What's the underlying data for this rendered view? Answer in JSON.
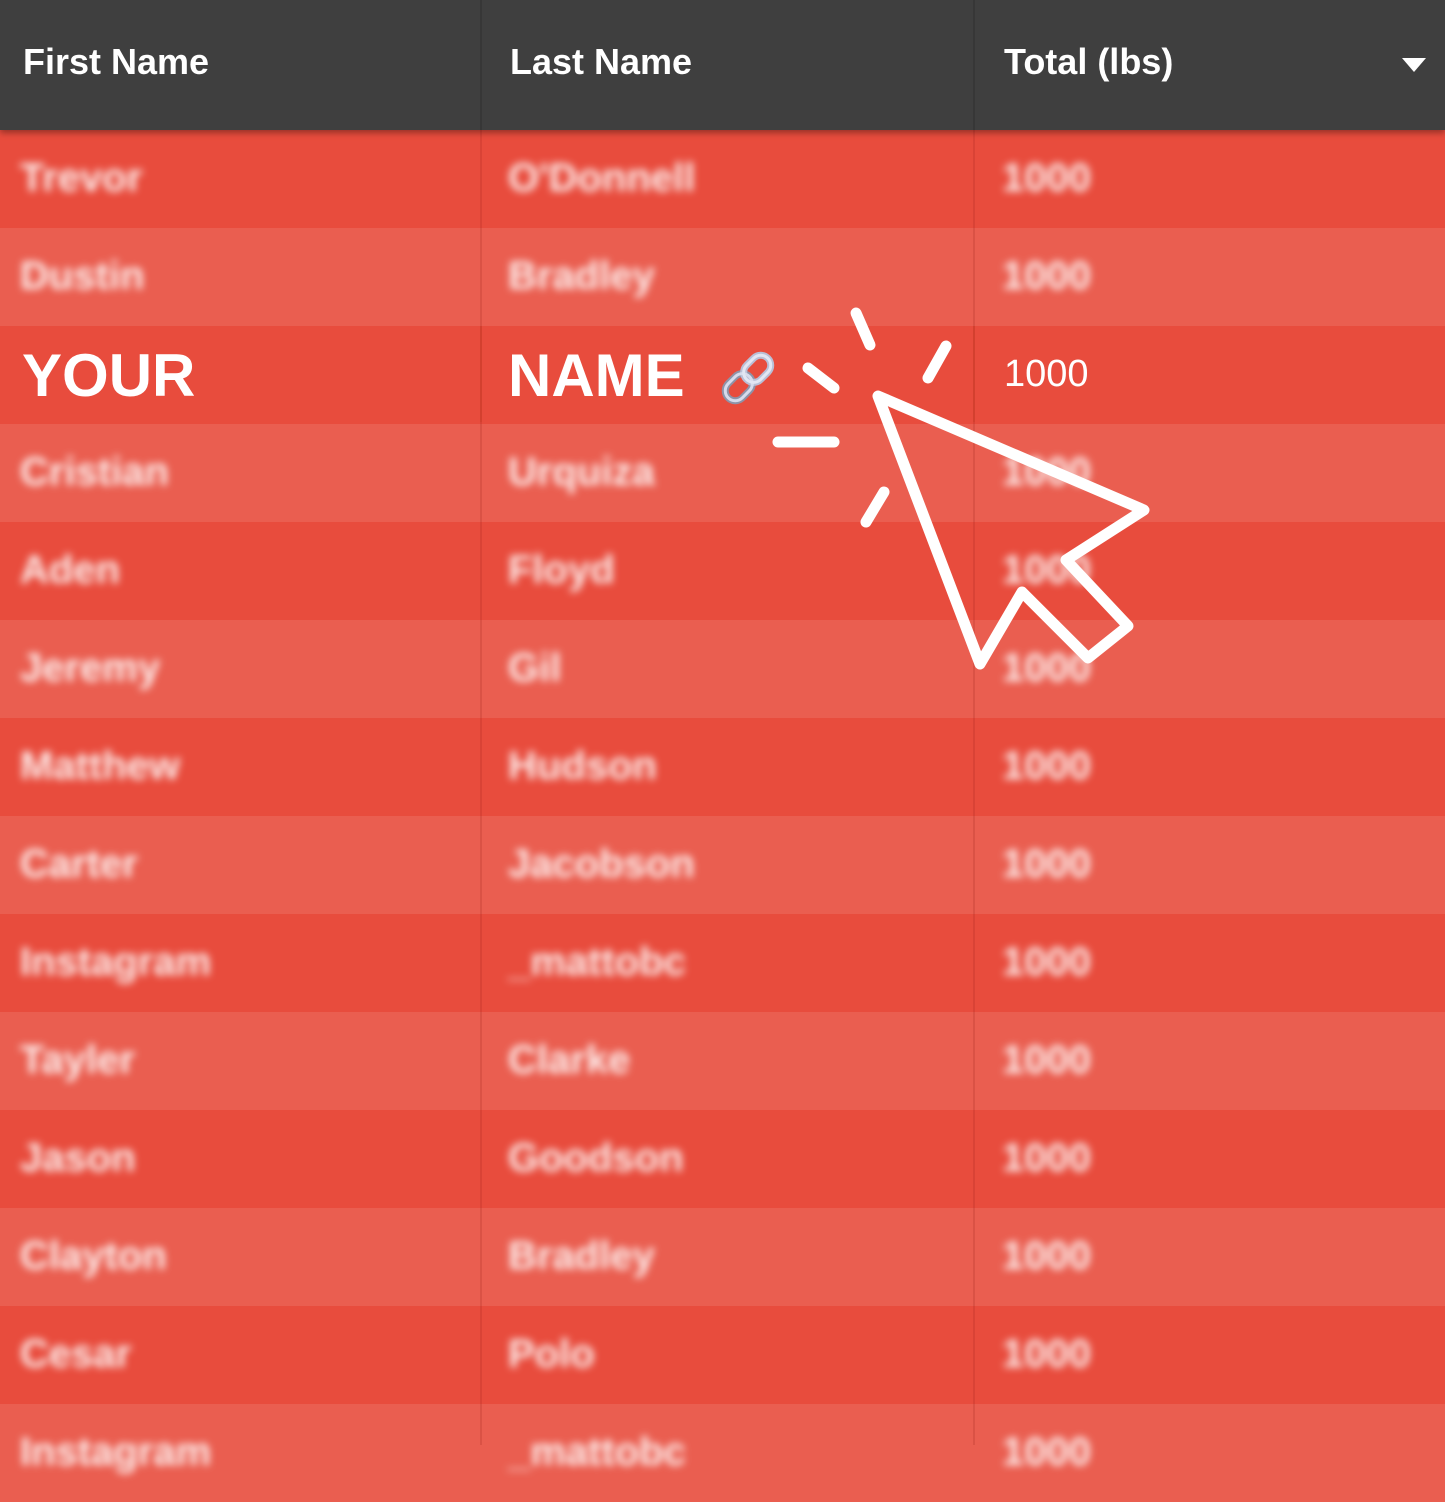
{
  "table": {
    "columns": [
      {
        "label": "First Name"
      },
      {
        "label": "Last Name"
      },
      {
        "label": "Total (lbs)"
      }
    ],
    "sort_icon": "caret-down-icon",
    "rows": [
      {
        "first": "Trevor",
        "last": "O'Donnell",
        "total": "1000"
      },
      {
        "first": "Dustin",
        "last": "Bradley",
        "total": "1000"
      },
      {
        "first": "YOUR",
        "last": "NAME",
        "total": "1000",
        "highlighted": true
      },
      {
        "first": "Cristian",
        "last": "Urquiza",
        "total": "1000"
      },
      {
        "first": "Aden",
        "last": "Floyd",
        "total": "1000"
      },
      {
        "first": "Jeremy",
        "last": "Gil",
        "total": "1000"
      },
      {
        "first": "Matthew",
        "last": "Hudson",
        "total": "1000"
      },
      {
        "first": "Carter",
        "last": "Jacobson",
        "total": "1000"
      },
      {
        "first": "Instagram",
        "last": "_mattobc",
        "total": "1000"
      },
      {
        "first": "Tayler",
        "last": "Clarke",
        "total": "1000"
      },
      {
        "first": "Jason",
        "last": "Goodson",
        "total": "1000"
      },
      {
        "first": "Clayton",
        "last": "Bradley",
        "total": "1000"
      },
      {
        "first": "Cesar",
        "last": "Polo",
        "total": "1000"
      },
      {
        "first": "Instagram",
        "last": "_mattobc",
        "total": "1000"
      }
    ]
  },
  "overlay": {
    "link_icon": "link-icon",
    "cursor_icon": "cursor-click-icon"
  },
  "colors": {
    "header_bg": "#3f3f3f",
    "row_odd": "#e84c3d",
    "row_even": "#ea5e50",
    "text": "#ffffff"
  }
}
